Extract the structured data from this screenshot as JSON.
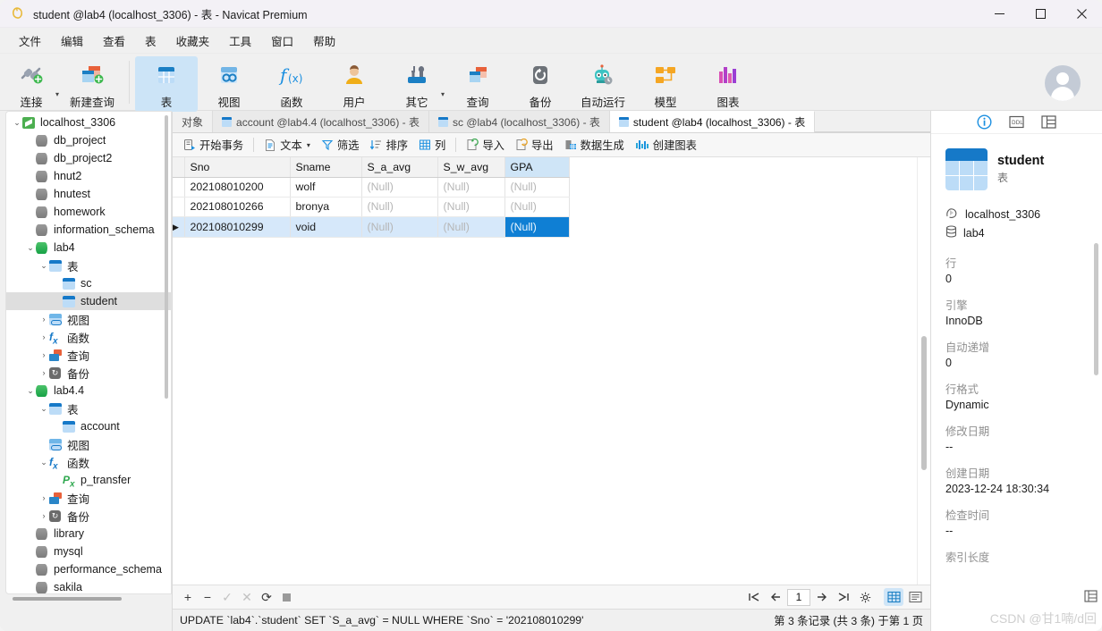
{
  "window": {
    "title": "student @lab4 (localhost_3306) - 表 - Navicat Premium",
    "app_icon": "navicat-icon",
    "minimize": "—",
    "maximize": "▢",
    "close": "✕"
  },
  "menubar": {
    "items": [
      {
        "label": "文件",
        "name": "menu-file"
      },
      {
        "label": "编辑",
        "name": "menu-edit"
      },
      {
        "label": "查看",
        "name": "menu-view"
      },
      {
        "label": "表",
        "name": "menu-table"
      },
      {
        "label": "收藏夹",
        "name": "menu-favorites"
      },
      {
        "label": "工具",
        "name": "menu-tools"
      },
      {
        "label": "窗口",
        "name": "menu-window"
      },
      {
        "label": "帮助",
        "name": "menu-help"
      }
    ]
  },
  "toolbar": {
    "items": [
      {
        "label": "连接",
        "icon": "connection-icon",
        "caret": true,
        "active": false
      },
      {
        "label": "新建查询",
        "icon": "new-query-icon",
        "caret": false,
        "active": false
      },
      {
        "label": "表",
        "icon": "table-icon",
        "caret": false,
        "active": true
      },
      {
        "label": "视图",
        "icon": "view-icon",
        "caret": false,
        "active": false
      },
      {
        "label": "函数",
        "icon": "function-icon",
        "caret": false,
        "active": false
      },
      {
        "label": "用户",
        "icon": "user-icon",
        "caret": false,
        "active": false
      },
      {
        "label": "其它",
        "icon": "other-icon",
        "caret": true,
        "active": false
      },
      {
        "label": "查询",
        "icon": "query-icon",
        "caret": false,
        "active": false
      },
      {
        "label": "备份",
        "icon": "backup-icon",
        "caret": false,
        "active": false
      },
      {
        "label": "自动运行",
        "icon": "automation-icon",
        "caret": false,
        "active": false
      },
      {
        "label": "模型",
        "icon": "model-icon",
        "caret": false,
        "active": false
      },
      {
        "label": "图表",
        "icon": "chart-icon",
        "caret": false,
        "active": false
      }
    ],
    "avatar": "user-avatar"
  },
  "sidebar": {
    "tree": [
      {
        "label": "localhost_3306",
        "indent": 0,
        "twisty": "v",
        "icon": "connection",
        "selected": false
      },
      {
        "label": "db_project",
        "indent": 1,
        "twisty": "",
        "icon": "db",
        "selected": false
      },
      {
        "label": "db_project2",
        "indent": 1,
        "twisty": "",
        "icon": "db",
        "selected": false
      },
      {
        "label": "hnut2",
        "indent": 1,
        "twisty": "",
        "icon": "db",
        "selected": false
      },
      {
        "label": "hnutest",
        "indent": 1,
        "twisty": "",
        "icon": "db",
        "selected": false
      },
      {
        "label": "homework",
        "indent": 1,
        "twisty": "",
        "icon": "db",
        "selected": false
      },
      {
        "label": "information_schema",
        "indent": 1,
        "twisty": "",
        "icon": "db",
        "selected": false
      },
      {
        "label": "lab4",
        "indent": 1,
        "twisty": "v",
        "icon": "db-green",
        "selected": false
      },
      {
        "label": "表",
        "indent": 2,
        "twisty": "v",
        "icon": "table",
        "selected": false
      },
      {
        "label": "sc",
        "indent": 3,
        "twisty": "",
        "icon": "table",
        "selected": false
      },
      {
        "label": "student",
        "indent": 3,
        "twisty": "",
        "icon": "table",
        "selected": true
      },
      {
        "label": "视图",
        "indent": 2,
        "twisty": ">",
        "icon": "view",
        "selected": false
      },
      {
        "label": "函数",
        "indent": 2,
        "twisty": ">",
        "icon": "fx",
        "selected": false
      },
      {
        "label": "查询",
        "indent": 2,
        "twisty": ">",
        "icon": "query",
        "selected": false
      },
      {
        "label": "备份",
        "indent": 2,
        "twisty": ">",
        "icon": "backup",
        "selected": false
      },
      {
        "label": "lab4.4",
        "indent": 1,
        "twisty": "v",
        "icon": "db-green",
        "selected": false
      },
      {
        "label": "表",
        "indent": 2,
        "twisty": "v",
        "icon": "table",
        "selected": false
      },
      {
        "label": "account",
        "indent": 3,
        "twisty": "",
        "icon": "table",
        "selected": false
      },
      {
        "label": "视图",
        "indent": 2,
        "twisty": "",
        "icon": "view",
        "selected": false
      },
      {
        "label": "函数",
        "indent": 2,
        "twisty": "v",
        "icon": "fx",
        "selected": false
      },
      {
        "label": "p_transfer",
        "indent": 3,
        "twisty": "",
        "icon": "proc",
        "selected": false
      },
      {
        "label": "查询",
        "indent": 2,
        "twisty": ">",
        "icon": "query",
        "selected": false
      },
      {
        "label": "备份",
        "indent": 2,
        "twisty": ">",
        "icon": "backup",
        "selected": false
      },
      {
        "label": "library",
        "indent": 1,
        "twisty": "",
        "icon": "db",
        "selected": false
      },
      {
        "label": "mysql",
        "indent": 1,
        "twisty": "",
        "icon": "db",
        "selected": false
      },
      {
        "label": "performance_schema",
        "indent": 1,
        "twisty": "",
        "icon": "db",
        "selected": false
      },
      {
        "label": "sakila",
        "indent": 1,
        "twisty": "",
        "icon": "db",
        "selected": false
      }
    ]
  },
  "tabs": {
    "objects_label": "对象",
    "items": [
      {
        "label": "account @lab4.4 (localhost_3306) - 表",
        "active": false
      },
      {
        "label": "sc @lab4 (localhost_3306) - 表",
        "active": false
      },
      {
        "label": "student @lab4 (localhost_3306) - 表",
        "active": true
      }
    ]
  },
  "grid_toolbar": {
    "items": [
      {
        "label": "开始事务",
        "icon": "begin-transaction-icon",
        "caret": false
      },
      {
        "label": "文本",
        "icon": "text-icon",
        "caret": true
      },
      {
        "label": "筛选",
        "icon": "filter-icon",
        "caret": false
      },
      {
        "label": "排序",
        "icon": "sort-icon",
        "caret": false
      },
      {
        "label": "列",
        "icon": "columns-icon",
        "caret": false
      },
      {
        "label": "导入",
        "icon": "import-icon",
        "caret": false
      },
      {
        "label": "导出",
        "icon": "export-icon",
        "caret": false
      },
      {
        "label": "数据生成",
        "icon": "data-generation-icon",
        "caret": false
      },
      {
        "label": "创建图表",
        "icon": "create-chart-icon",
        "caret": false
      }
    ]
  },
  "grid": {
    "columns": [
      "Sno",
      "Sname",
      "S_a_avg",
      "S_w_avg",
      "GPA"
    ],
    "selected_column": "GPA",
    "rows": [
      {
        "cells": [
          "202108010200",
          "wolf",
          "(Null)",
          "(Null)",
          "(Null)"
        ],
        "selected": false
      },
      {
        "cells": [
          "202108010266",
          "bronya",
          "(Null)",
          "(Null)",
          "(Null)"
        ],
        "selected": false
      },
      {
        "cells": [
          "202108010299",
          "void",
          "(Null)",
          "(Null)",
          "(Null)"
        ],
        "selected": true
      }
    ],
    "selected_cell": {
      "row": 2,
      "column": 4
    },
    "row_marker": "▶"
  },
  "grid_footer": {
    "add": "+",
    "remove": "−",
    "apply": "✓",
    "cancel": "✕",
    "refresh": "⟳",
    "stop": "stop-icon",
    "first": "|←",
    "prev": "←",
    "page": "1",
    "next": "→",
    "last": "→|",
    "settings": "gear-icon",
    "view_grid": "grid-view-icon",
    "view_form": "form-view-icon"
  },
  "status": {
    "sql": "UPDATE `lab4`.`student` SET `S_a_avg` = NULL WHERE `Sno` = '202108010299'",
    "record_info": "第 3 条记录 (共 3 条) 于第 1 页"
  },
  "info_panel": {
    "tabs": [
      {
        "icon": "info-icon",
        "name": "info-tab",
        "active": true
      },
      {
        "icon": "ddl-icon",
        "name": "ddl-tab",
        "active": false
      },
      {
        "icon": "preview-icon",
        "name": "preview-tab",
        "active": false
      }
    ],
    "object_name": "student",
    "object_type": "表",
    "connection": "localhost_3306",
    "database": "lab4",
    "properties": [
      {
        "key": "行",
        "value": "0"
      },
      {
        "key": "引擎",
        "value": "InnoDB"
      },
      {
        "key": "自动递增",
        "value": "0"
      },
      {
        "key": "行格式",
        "value": "Dynamic"
      },
      {
        "key": "修改日期",
        "value": "--"
      },
      {
        "key": "创建日期",
        "value": "2023-12-24 18:30:34"
      },
      {
        "key": "检查时间",
        "value": "--"
      },
      {
        "key": "索引长度",
        "value": ""
      }
    ],
    "last_property_partial": "索引长度"
  },
  "watermark": "CSDN @甘1喃/d回",
  "colors": {
    "accent": "#0f7fd4",
    "selected_row": "#d6e8fa",
    "selected_header": "#cfe5f7",
    "toolbar_active": "#cce4f7",
    "null_text": "#b6b6b6"
  }
}
